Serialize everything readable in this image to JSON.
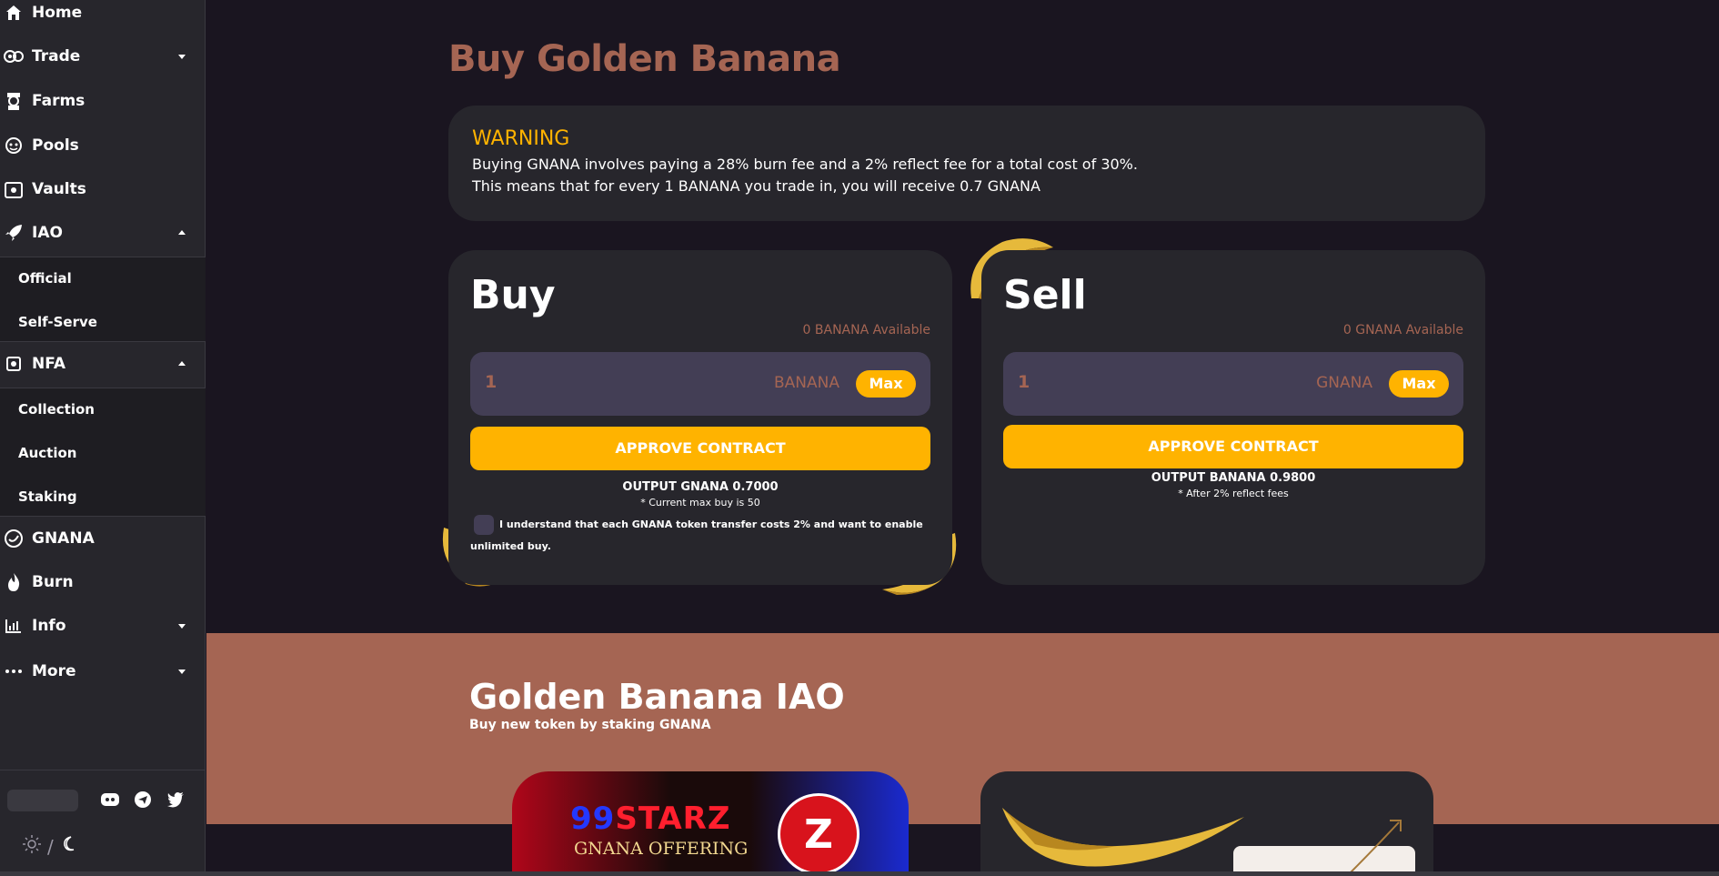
{
  "sidebar": {
    "items": [
      {
        "label": "Home"
      },
      {
        "label": "Trade"
      },
      {
        "label": "Farms"
      },
      {
        "label": "Pools"
      },
      {
        "label": "Vaults"
      },
      {
        "label": "IAO"
      },
      {
        "label": "NFA"
      },
      {
        "label": "GNANA"
      },
      {
        "label": "Burn"
      },
      {
        "label": "Info"
      },
      {
        "label": "More"
      }
    ],
    "iao_sub": [
      "Official",
      "Self-Serve"
    ],
    "nfa_sub": [
      "Collection",
      "Auction",
      "Staking"
    ],
    "theme_sep": "/"
  },
  "main": {
    "title": "Buy Golden Banana",
    "warning": {
      "title": "WARNING",
      "line1": "Buying GNANA involves paying a 28% burn fee and a 2% reflect fee for a total cost of 30%.",
      "line2": "This means that for every 1 BANANA you trade in, you will receive 0.7 GNANA"
    },
    "buy": {
      "title": "Buy",
      "available": "0 BANANA Available",
      "input_value": "1",
      "token": "BANANA",
      "max": "Max",
      "approve": "APPROVE CONTRACT",
      "output": "OUTPUT GNANA 0.7000",
      "note": "* Current max buy is 50",
      "checkbox_text": "I understand that each GNANA token transfer costs 2% and want to enable unlimited buy."
    },
    "sell": {
      "title": "Sell",
      "available": "0 GNANA Available",
      "input_value": "1",
      "token": "GNANA",
      "max": "Max",
      "approve": "APPROVE CONTRACT",
      "output": "OUTPUT BANANA 0.9800",
      "note": "* After 2% reflect fees"
    }
  },
  "iao": {
    "title": "Golden Banana IAO",
    "subtitle": "Buy new token by staking GNANA",
    "promo_brand_a": "99",
    "promo_brand_b": "STARZ",
    "promo_tagline": "GNANA OFFERING",
    "promo_logo": "Z"
  },
  "colors": {
    "accent": "#ffb300",
    "brand_brown": "#a56553",
    "card_bg": "#27262c",
    "page_bg": "#1a1520",
    "input_bg": "#433e55"
  }
}
